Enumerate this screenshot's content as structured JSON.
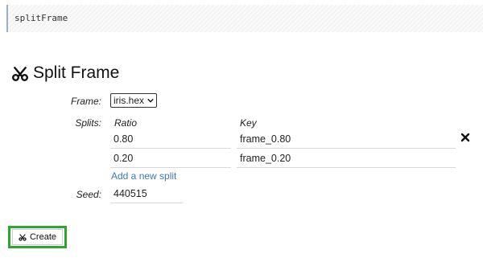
{
  "code_cell": {
    "text": "splitFrame"
  },
  "form": {
    "title": "Split Frame",
    "title_icon": "scissors-icon",
    "frame": {
      "label": "Frame:",
      "selected": "iris.hex"
    },
    "splits": {
      "label": "Splits:",
      "ratio_header": "Ratio",
      "key_header": "Key",
      "rows": [
        {
          "ratio": "0.80",
          "key": "frame_0.80"
        },
        {
          "ratio": "0.20",
          "key": "frame_0.20"
        }
      ],
      "add_label": "Add a new split"
    },
    "seed": {
      "label": "Seed:",
      "value": "440515"
    },
    "create_label": "Create"
  },
  "colors": {
    "link": "#3f78b6",
    "highlight_outline": "#2ea52e",
    "code_border": "#9bb0c4"
  }
}
